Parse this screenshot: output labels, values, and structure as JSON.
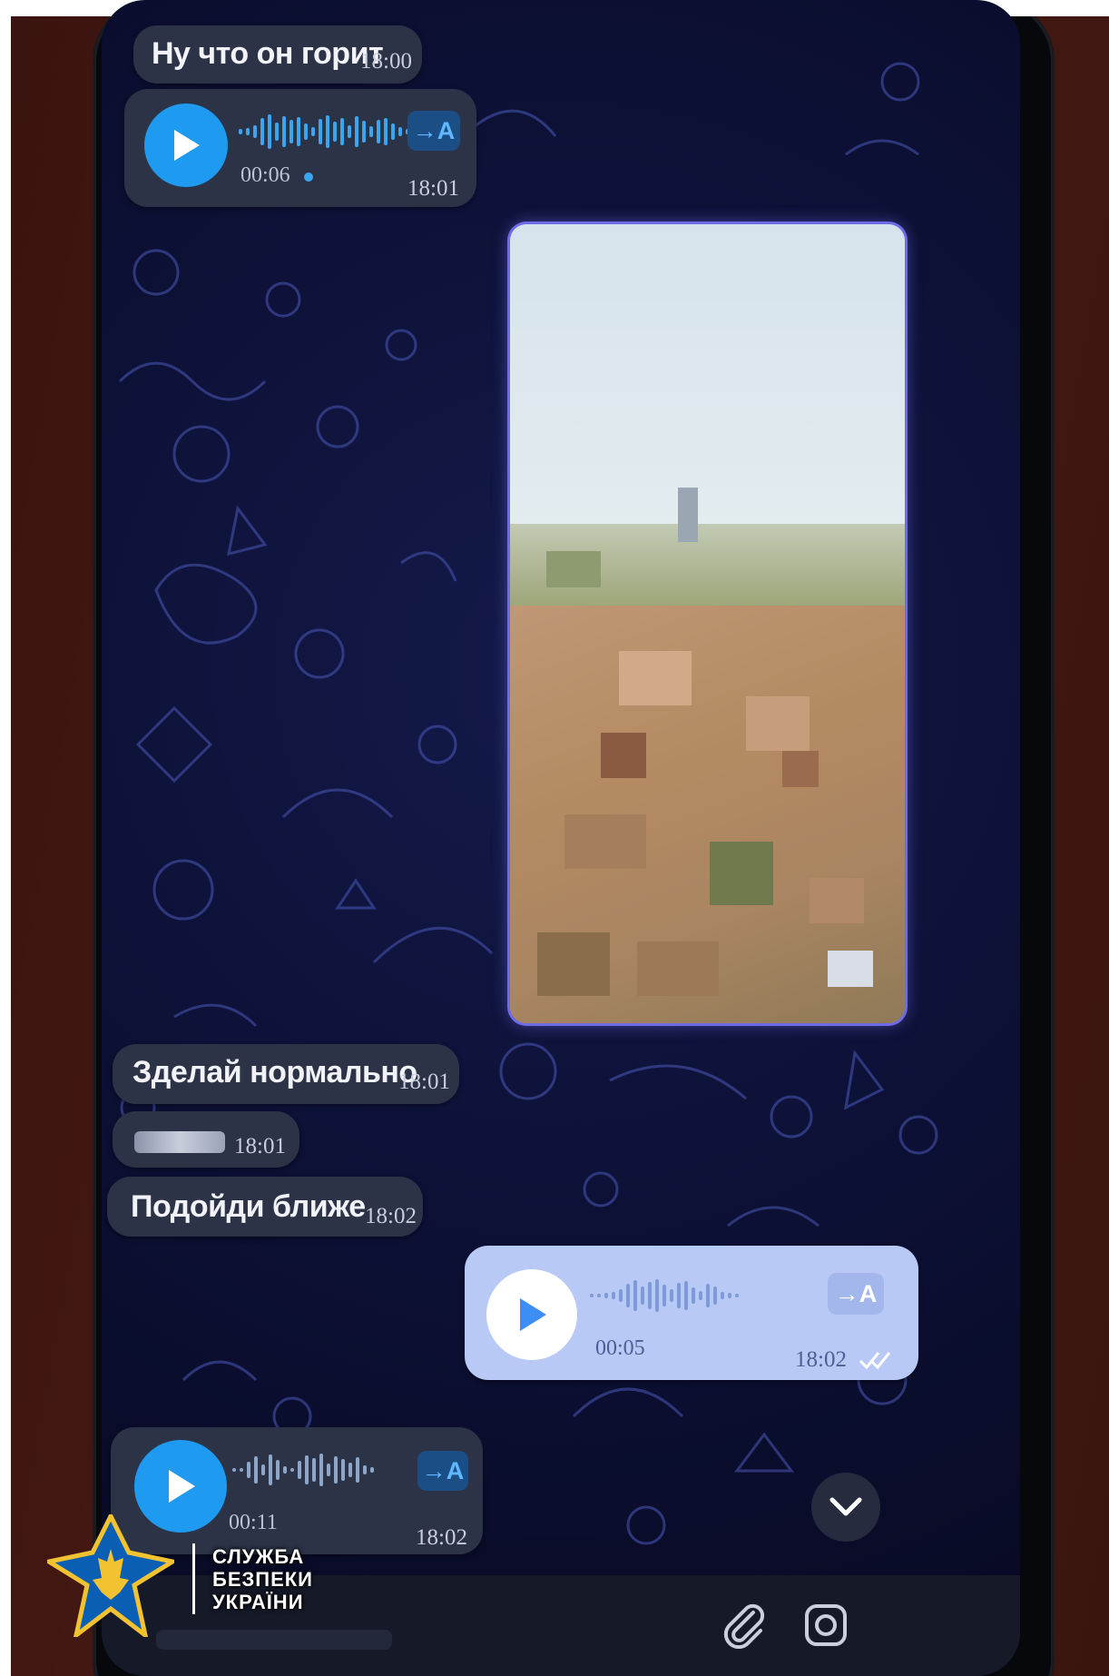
{
  "messages": {
    "m1": {
      "text": "Ну что он горит",
      "time": "18:00"
    },
    "voice1": {
      "duration": "00:06",
      "time": "18:01",
      "transcribe": "→A"
    },
    "m2": {
      "text": "Зделай нормально",
      "time": "18:01"
    },
    "m3": {
      "time": "18:01"
    },
    "m4": {
      "text": "Подойди ближе",
      "time": "18:02"
    },
    "voice_out": {
      "duration": "00:05",
      "time": "18:02",
      "transcribe": "→A",
      "status": "read"
    },
    "voice2": {
      "duration": "00:11",
      "time": "18:02",
      "transcribe": "→A"
    }
  },
  "logo": {
    "line1": "СЛУЖБА",
    "line2": "БЕЗПЕКИ",
    "line3": "УКРАЇНИ"
  },
  "colors": {
    "incoming_bubble": "#2c3346",
    "outgoing_bubble": "#b8c9f6",
    "accent": "#1e9af0",
    "chat_background": "#0c1034"
  },
  "icons": {
    "scroll_down": "chevron-down-icon",
    "attach": "paperclip-icon",
    "camera": "camera-icon"
  }
}
